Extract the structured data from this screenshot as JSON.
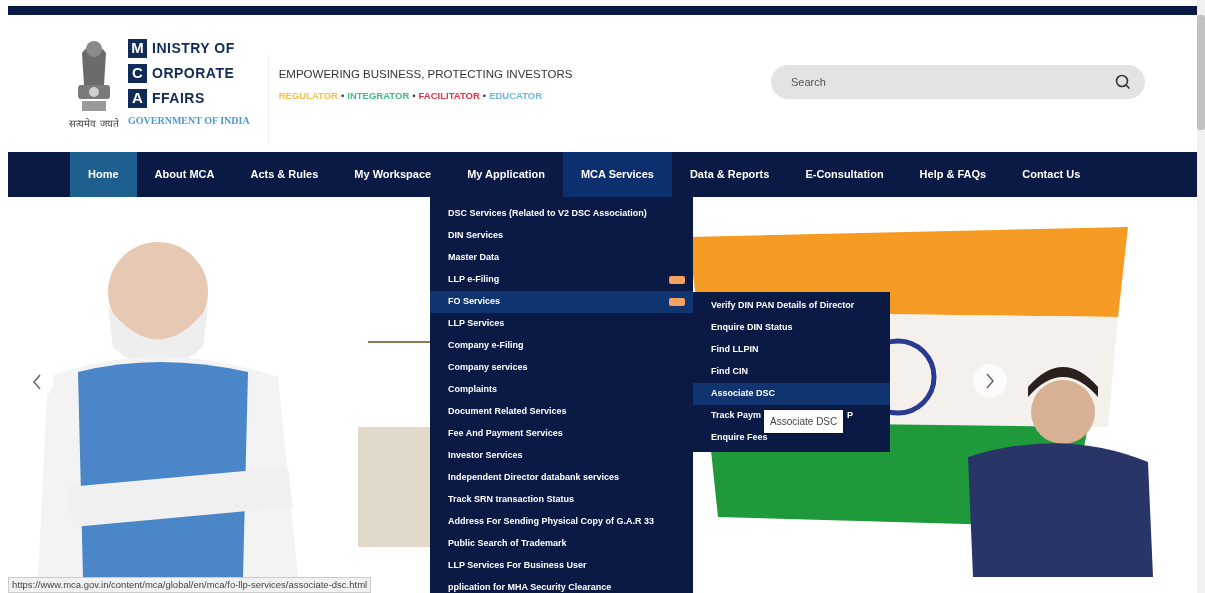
{
  "logo": {
    "motto": "सत्यमेव जयते",
    "lines": [
      {
        "initial": "M",
        "rest": "INISTRY OF"
      },
      {
        "initial": "C",
        "rest": "ORPORATE"
      },
      {
        "initial": "A",
        "rest": "FFAIRS"
      }
    ],
    "subtitle": "GOVERNMENT OF INDIA"
  },
  "tagline": {
    "title": "EMPOWERING BUSINESS, PROTECTING INVESTORS",
    "roles": [
      {
        "label": "REGULATOR",
        "color": "#f2c14e"
      },
      {
        "label": "INTEGRATOR",
        "color": "#3dbb8a"
      },
      {
        "label": "FACILITATOR",
        "color": "#e0344b"
      },
      {
        "label": "EDUCATOR",
        "color": "#6cb8e0"
      }
    ],
    "separator": "•"
  },
  "search": {
    "placeholder": "Search"
  },
  "nav": [
    {
      "label": "Home",
      "selected": true,
      "open": false
    },
    {
      "label": "About MCA",
      "selected": false,
      "open": false
    },
    {
      "label": "Acts & Rules",
      "selected": false,
      "open": false
    },
    {
      "label": "My Workspace",
      "selected": false,
      "open": false
    },
    {
      "label": "My Application",
      "selected": false,
      "open": false
    },
    {
      "label": "MCA Services",
      "selected": false,
      "open": true
    },
    {
      "label": "Data & Reports",
      "selected": false,
      "open": false
    },
    {
      "label": "E-Consultation",
      "selected": false,
      "open": false
    },
    {
      "label": "Help & FAQs",
      "selected": false,
      "open": false
    },
    {
      "label": "Contact Us",
      "selected": false,
      "open": false
    }
  ],
  "dropdown": [
    {
      "label": "DSC Services (Related to V2 DSC Association)",
      "selected": false,
      "has_submenu": false
    },
    {
      "label": "DIN Services",
      "selected": false,
      "has_submenu": false
    },
    {
      "label": "Master Data",
      "selected": false,
      "has_submenu": false
    },
    {
      "label": "LLP e-Filing",
      "selected": false,
      "has_submenu": true
    },
    {
      "label": "FO Services",
      "selected": true,
      "has_submenu": true
    },
    {
      "label": "LLP Services",
      "selected": false,
      "has_submenu": false
    },
    {
      "label": "Company e-Filing",
      "selected": false,
      "has_submenu": false
    },
    {
      "label": "Company services",
      "selected": false,
      "has_submenu": false
    },
    {
      "label": "Complaints",
      "selected": false,
      "has_submenu": false
    },
    {
      "label": "Document Related Services",
      "selected": false,
      "has_submenu": false
    },
    {
      "label": "Fee And Payment Services",
      "selected": false,
      "has_submenu": false
    },
    {
      "label": "Investor Services",
      "selected": false,
      "has_submenu": false
    },
    {
      "label": "Independent Director databank services",
      "selected": false,
      "has_submenu": false
    },
    {
      "label": "Track SRN transaction Status",
      "selected": false,
      "has_submenu": false
    },
    {
      "label": "Address For Sending Physical Copy of G.A.R 33",
      "selected": false,
      "has_submenu": false
    },
    {
      "label": "Public Search of Trademark",
      "selected": false,
      "has_submenu": false
    },
    {
      "label": "LLP Services For Business User",
      "selected": false,
      "has_submenu": false
    },
    {
      "label": "pplication for MHA Security Clearance",
      "selected": false,
      "has_submenu": false
    }
  ],
  "submenu": [
    {
      "label": "Verify DIN PAN Details of Director",
      "selected": false
    },
    {
      "label": "Enquire DIN Status",
      "selected": false
    },
    {
      "label": "Find LLPIN",
      "selected": false
    },
    {
      "label": "Find CIN",
      "selected": false
    },
    {
      "label": "Associate DSC",
      "selected": true
    },
    {
      "label": "Track Paym",
      "after_tooltip": "P",
      "selected": false
    },
    {
      "label": "Enquire Fees",
      "selected": false
    }
  ],
  "tooltip": "Associate DSC",
  "status_bar": "https://www.mca.gov.in/content/mca/global/en/mca/fo-llp-services/associate-dsc.html"
}
